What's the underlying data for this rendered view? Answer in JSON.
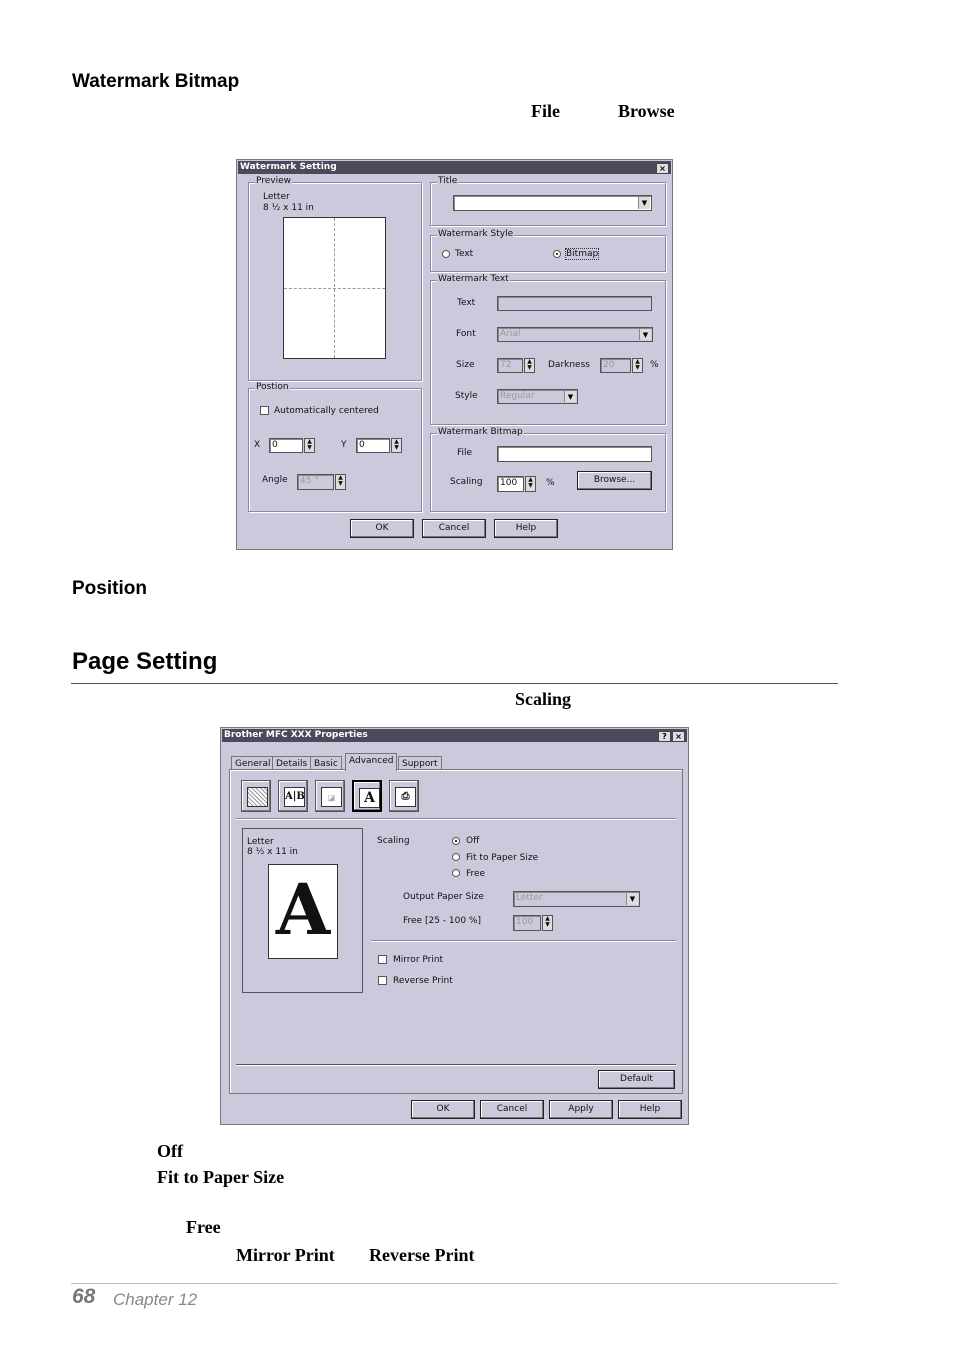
{
  "headings": {
    "watermark_bitmap": "Watermark Bitmap",
    "position": "Position",
    "page_setting": "Page Setting"
  },
  "inline_terms": {
    "file": "File",
    "browse": "Browse",
    "scaling": "Scaling",
    "off": "Off",
    "fit_to_paper_size": "Fit to Paper Size",
    "free": "Free",
    "mirror_print": "Mirror Print",
    "reverse_print": "Reverse Print"
  },
  "footer": {
    "page_number": "68",
    "chapter": "Chapter 12"
  },
  "watermark_dialog": {
    "title": "Watermark Setting",
    "close": "×",
    "preview": {
      "label": "Preview",
      "paper": "Letter",
      "paper_size": "8 ½ x 11 in"
    },
    "position": {
      "label": "Postion",
      "auto_centered": "Automatically centered",
      "x_label": "X",
      "x_value": "0",
      "y_label": "Y",
      "y_value": "0",
      "angle_label": "Angle",
      "angle_value": "45 °"
    },
    "title_group": {
      "label": "Title",
      "value": ""
    },
    "style_group": {
      "label": "Watermark Style",
      "text_option": "Text",
      "bitmap_option": "Bitmap"
    },
    "text_group": {
      "label": "Watermark Text",
      "text_label": "Text",
      "font_label": "Font",
      "font_value": "Arial",
      "size_label": "Size",
      "size_value": "72",
      "darkness_label": "Darkness",
      "darkness_value": "20",
      "percent": "%",
      "style_label": "Style",
      "style_value": "Regular"
    },
    "bitmap_group": {
      "label": "Watermark Bitmap",
      "file_label": "File",
      "file_value": "",
      "scaling_label": "Scaling",
      "scaling_value": "100",
      "percent": "%",
      "browse_button": "Browse..."
    },
    "buttons": {
      "ok": "OK",
      "cancel": "Cancel",
      "help": "Help"
    }
  },
  "props_dialog": {
    "title": "Brother MFC XXX Properties",
    "help_btn": "?",
    "close": "×",
    "tabs": [
      "General",
      "Details",
      "Basic",
      "Advanced",
      "Support"
    ],
    "preview": {
      "paper": "Letter",
      "paper_size": "8 ½ x 11 in",
      "glyph": "A"
    },
    "scaling": {
      "label": "Scaling",
      "off": "Off",
      "fit": "Fit to Paper Size",
      "free": "Free",
      "output_label": "Output Paper Size",
      "output_value": "Letter",
      "free_label": "Free [25 - 100 %]",
      "free_value": "100"
    },
    "mirror_print": "Mirror Print",
    "reverse_print": "Reverse Print",
    "default_button": "Default",
    "buttons": {
      "ok": "OK",
      "cancel": "Cancel",
      "apply": "Apply",
      "help": "Help"
    }
  }
}
